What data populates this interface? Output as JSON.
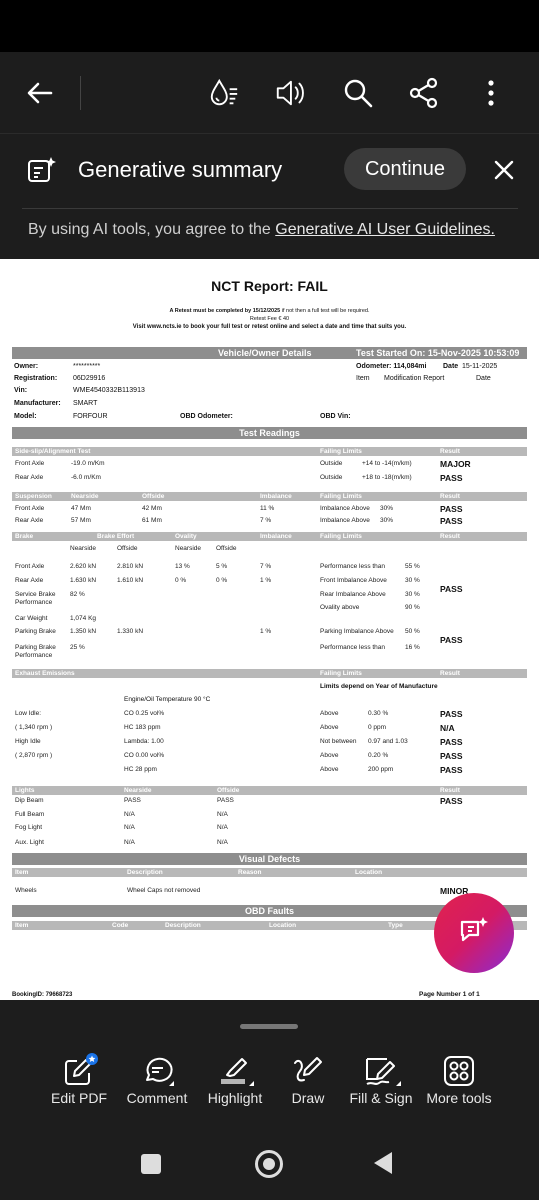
{
  "toolbar": {
    "icons": [
      "back-arrow-icon",
      "liquid-mode-icon",
      "read-aloud-icon",
      "search-icon",
      "share-icon",
      "more-icon"
    ]
  },
  "generative": {
    "title": "Generative summary",
    "continue_label": "Continue",
    "notice_prefix": "By using AI tools, you agree to the ",
    "notice_link": "Generative AI User Guidelines."
  },
  "report": {
    "title": "NCT Report: FAIL",
    "retest_line": "A Retest must be completed by 15/12/2025",
    "retest_note": "if not then a full test will be required.",
    "retest_fee": "Retest Fee € 40",
    "visit_line": "Visit www.ncts.ie to book your full test or retest online and select a date and time that suits you.",
    "vehicle_header": "Vehicle/Owner Details",
    "test_started": "Test Started On: 15-Nov-2025 10:53:09",
    "owner_label": "Owner:",
    "owner_value": "**********",
    "registration_label": "Registration:",
    "registration_value": "06D29916",
    "vin_label": "Vin:",
    "vin_value": "WME4540332B113913",
    "manufacturer_label": "Manufacturer:",
    "manufacturer_value": "SMART",
    "model_label": "Model:",
    "model_value": "FORFOUR",
    "obd_odometer_label": "OBD Odometer:",
    "obd_vin_label": "OBD Vin:",
    "odometer_label": "Odometer: 114,084mi",
    "date_label": "Date",
    "date_value": "15-11-2025",
    "item_label": "Item",
    "modification_label": "Modification Report",
    "date_label2": "Date",
    "test_readings_header": "Test Readings",
    "sideslip": {
      "headers": [
        "Side-slip/Alignment Test",
        "Failing Limits",
        "Result"
      ],
      "rows": [
        {
          "item": "Front Axle",
          "value": "-19.0 m/Km",
          "limit": "Outside",
          "range": "+14 to -14(m/km)",
          "result": "MAJOR"
        },
        {
          "item": "Rear Axle",
          "value": "-6.0 m/Km",
          "limit": "Outside",
          "range": "+18 to -18(m/km)",
          "result": "PASS"
        }
      ]
    },
    "suspension": {
      "headers": [
        "Suspension",
        "Nearside",
        "Offside",
        "Imbalance",
        "Failing Limits",
        "Result"
      ],
      "rows": [
        {
          "item": "Front Axle",
          "near": "47 Mm",
          "off": "42 Mm",
          "imb": "11 %",
          "limit": "Imbalance Above",
          "pct": "30%",
          "result": "PASS"
        },
        {
          "item": "Rear Axle",
          "near": "57 Mm",
          "off": "61 Mm",
          "imb": "7 %",
          "limit": "Imbalance Above",
          "pct": "30%",
          "result": "PASS"
        }
      ]
    },
    "brake": {
      "headers": [
        "Brake",
        "Brake Effort",
        "Ovality",
        "Imbalance",
        "Failing Limits",
        "Result"
      ],
      "subheaders": [
        "Nearside",
        "Offside",
        "Nearside",
        "Offside"
      ],
      "rows": [
        {
          "item": "Front Axle",
          "n": "2.620 kN",
          "o": "2.810 kN",
          "ovn": "13 %",
          "ovo": "5 %",
          "imb": "7 %",
          "limit": "Performance less than",
          "pct": "55 %"
        },
        {
          "item": "Rear Axle",
          "n": "1.630 kN",
          "o": "1.610 kN",
          "ovn": "0 %",
          "ovo": "0 %",
          "imb": "1 %",
          "limit": "Front Imbalance Above",
          "pct": "30 %"
        },
        {
          "item": "Service Brake Performance",
          "n": "82 %",
          "limit": "Rear Imbalance Above",
          "pct": "30 %"
        },
        {
          "limit": "Ovality above",
          "pct": "90 %"
        },
        {
          "item": "Car Weight",
          "n": "1,074 Kg"
        },
        {
          "item": "Parking Brake",
          "n": "1.350 kN",
          "o": "1.330 kN",
          "imb": "1 %",
          "limit": "Parking Imbalance Above",
          "pct": "50 %"
        },
        {
          "item": "Parking Brake Performance",
          "n": "25 %",
          "limit": "Performance less than",
          "pct": "16 %"
        }
      ],
      "result1": "PASS",
      "result2": "PASS"
    },
    "exhaust": {
      "headers": [
        "Exhaust Emissions",
        "Failing Limits",
        "Result"
      ],
      "limits_note": "Limits depend on Year of Manufacture",
      "engine_temp": "Engine/Oil Temperature 90 °C",
      "rows": [
        {
          "item": "Low Idle:",
          "val": "CO 0.25 vol%",
          "limit": "Above",
          "range": "0.30 %",
          "result": "PASS"
        },
        {
          "item": "( 1,340 rpm )",
          "val": "HC 183 ppm",
          "limit": "Above",
          "range": "0 ppm",
          "result": "N/A"
        },
        {
          "item": "High Idle",
          "val": "Lambda: 1.00",
          "limit": "Not between",
          "range": "0.97 and 1.03",
          "result": "PASS"
        },
        {
          "item": "( 2,870 rpm )",
          "val": "CO 0.00 vol%",
          "limit": "Above",
          "range": "0.20 %",
          "result": "PASS"
        },
        {
          "item": "",
          "val": "HC 28 ppm",
          "limit": "Above",
          "range": "200 ppm",
          "result": "PASS"
        }
      ]
    },
    "lights": {
      "headers": [
        "Lights",
        "Nearside",
        "Offside",
        "Result"
      ],
      "rows": [
        {
          "item": "Dip Beam",
          "near": "PASS",
          "off": "PASS",
          "result": "PASS"
        },
        {
          "item": "Full Beam",
          "near": "N/A",
          "off": "N/A"
        },
        {
          "item": "Fog Light",
          "near": "N/A",
          "off": "N/A"
        },
        {
          "item": "Aux. Light",
          "near": "N/A",
          "off": "N/A"
        }
      ]
    },
    "visual": {
      "header": "Visual Defects",
      "cols": [
        "Item",
        "Description",
        "Reason",
        "Location"
      ],
      "rows": [
        {
          "item": "Wheels",
          "desc": "Wheel Caps not removed",
          "result": "MINOR"
        }
      ]
    },
    "obd": {
      "header": "OBD Faults",
      "cols": [
        "Item",
        "Code",
        "Description",
        "Location",
        "Type"
      ]
    },
    "booking": "BookingID: 79668723",
    "page": "Page Number 1 of 1"
  },
  "bottom_tools": [
    {
      "label": "Edit PDF",
      "icon": "edit-pdf-icon"
    },
    {
      "label": "Comment",
      "icon": "comment-icon"
    },
    {
      "label": "Highlight",
      "icon": "highlight-icon"
    },
    {
      "label": "Draw",
      "icon": "draw-icon"
    },
    {
      "label": "Fill & Sign",
      "icon": "fill-sign-icon"
    },
    {
      "label": "More tools",
      "icon": "more-tools-icon"
    }
  ],
  "colors": {
    "bar": "#8e8e8e",
    "subbar": "#b8b8b8",
    "fab_start": "#e0234e",
    "fab_end": "#8a2bd4",
    "badge": "#1a73e8"
  }
}
